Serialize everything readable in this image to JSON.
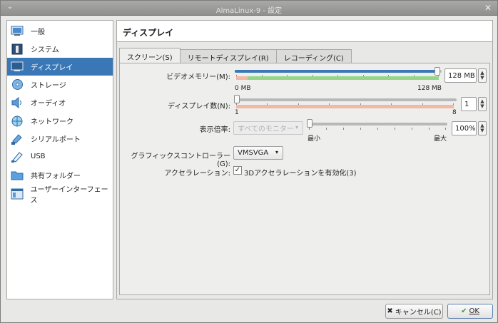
{
  "window": {
    "title": "AlmaLinux-9 - 設定"
  },
  "sidebar": {
    "items": [
      {
        "label": "一般",
        "icon": "general-icon"
      },
      {
        "label": "システム",
        "icon": "system-icon"
      },
      {
        "label": "ディスプレイ",
        "icon": "display-icon",
        "selected": true
      },
      {
        "label": "ストレージ",
        "icon": "storage-icon"
      },
      {
        "label": "オーディオ",
        "icon": "audio-icon"
      },
      {
        "label": "ネットワーク",
        "icon": "network-icon"
      },
      {
        "label": "シリアルポート",
        "icon": "serial-port-icon"
      },
      {
        "label": "USB",
        "icon": "usb-icon"
      },
      {
        "label": "共有フォルダー",
        "icon": "shared-folder-icon"
      },
      {
        "label": "ユーザーインターフェース",
        "icon": "user-interface-icon"
      }
    ]
  },
  "header": {
    "title": "ディスプレイ"
  },
  "tabs": [
    {
      "label": "スクリーン(S)",
      "active": true
    },
    {
      "label": "リモートディスプレイ(R)"
    },
    {
      "label": "レコーディング(C)"
    }
  ],
  "screen": {
    "video_memory": {
      "label": "ビデオメモリー(M):",
      "value": "128 MB",
      "min_label": "0 MB",
      "max_label": "128 MB",
      "fraction": 1.0
    },
    "monitor_count": {
      "label": "ディスプレイ数(N):",
      "value": "1",
      "min_label": "1",
      "max_label": "8",
      "fraction": 0.0
    },
    "scale_factor": {
      "label": "表示倍率:",
      "monitor_select": "すべてのモニター",
      "value": "100%",
      "min_label": "最小",
      "max_label": "最大",
      "fraction": 0.0
    },
    "graphics_controller": {
      "label": "グラフィックスコントローラー(G):",
      "value": "VMSVGA"
    },
    "acceleration": {
      "label": "アクセラレーション:",
      "checkbox_label": "3Dアクセラレーションを有効化(3)",
      "checked": true,
      "check_mark": "✓"
    }
  },
  "buttons": {
    "cancel": "キャンセル(C)",
    "ok": "OK"
  },
  "colors": {
    "accent": "#3a77b6",
    "vram_green": "#96d68a",
    "vram_red": "#f2b8a6"
  }
}
